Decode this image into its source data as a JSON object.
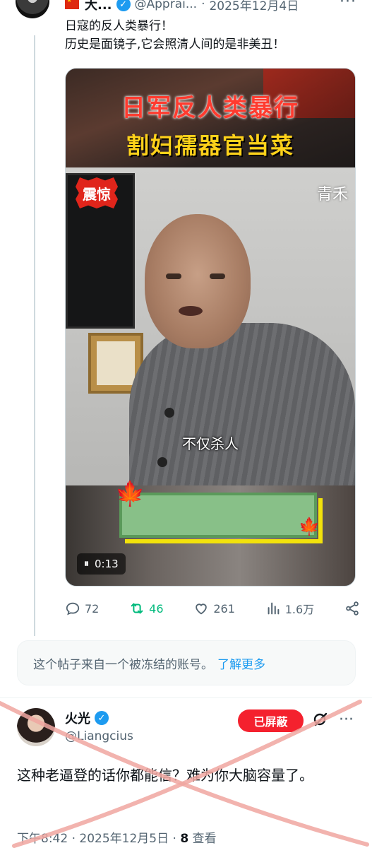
{
  "post": {
    "display_name": "大...",
    "handle": "@Apprai...",
    "separator": "·",
    "date": "2025年12月4日",
    "more": "···",
    "text_line1": "日寇的反人类暴行！",
    "text_line2": "历史是面镜子,它会照清人间的是非美丑！",
    "media": {
      "banner_title1": "日军反人类暴行",
      "banner_title2": "割妇孺器官当菜",
      "badge": "震惊",
      "watermark": "青禾",
      "subtitle": "不仅杀人",
      "timestamp": "0:13",
      "pause_icon": "⏸"
    },
    "actions": {
      "replies": "72",
      "retweets": "46",
      "likes": "261",
      "views": "1.6万"
    }
  },
  "notice": {
    "text": "这个帖子来自一个被冻结的账号。",
    "link": "了解更多"
  },
  "reply": {
    "display_name": "火光",
    "handle": "@Liangcius",
    "blocked_label": "已屏蔽",
    "more": "···",
    "text": "这种老逼登的话你都能信？难为你大脑容量了。",
    "time": "下午8:42 · 2025年12月5日 · ",
    "views_count": "8",
    "views_label": " 查看"
  },
  "colors": {
    "accent": "#1d9bf0",
    "retweet": "#00ba7c",
    "blocked": "#f4212e",
    "cross": "#f0a6a0"
  }
}
